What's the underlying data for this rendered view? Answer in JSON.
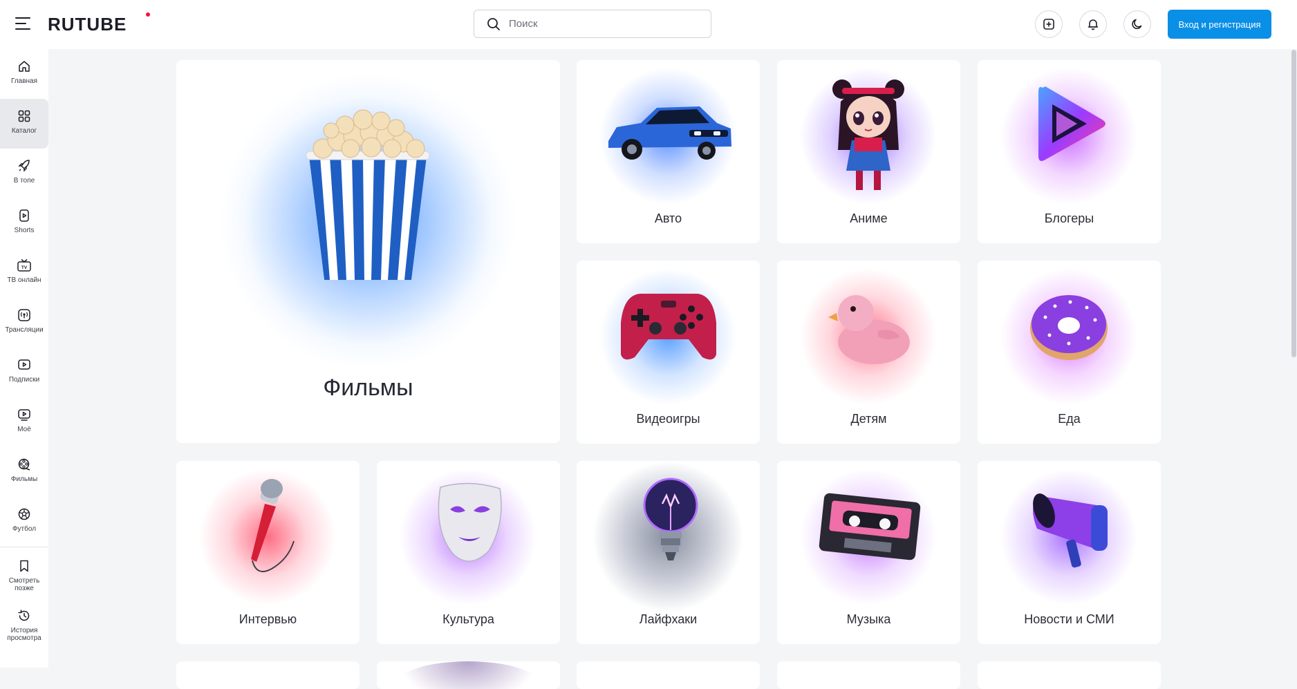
{
  "header": {
    "logo_text": "RUTUBE",
    "search_placeholder": "Поиск",
    "upload_icon": "plus-square-icon",
    "notifications_icon": "bell-icon",
    "theme_icon": "moon-icon",
    "login_label": "Вход и регистрация"
  },
  "sidebar": {
    "items": [
      {
        "label": "Главная",
        "icon": "home-icon"
      },
      {
        "label": "Каталог",
        "icon": "grid-icon",
        "active": true
      },
      {
        "label": "В топе",
        "icon": "rocket-icon"
      },
      {
        "label": "Shorts",
        "icon": "shorts-icon"
      },
      {
        "label": "ТВ онлайн",
        "icon": "tv-icon"
      },
      {
        "label": "Трансляции",
        "icon": "broadcast-icon"
      },
      {
        "label": "Подписки",
        "icon": "subscriptions-icon"
      },
      {
        "label": "Моё",
        "icon": "my-icon"
      },
      {
        "label": "Фильмы",
        "icon": "film-reel-icon"
      },
      {
        "label": "Футбол",
        "icon": "football-icon"
      },
      {
        "label": "Смотреть позже",
        "icon": "bookmark-icon"
      },
      {
        "label": "История просмотра",
        "icon": "history-icon"
      }
    ]
  },
  "catalog": {
    "featured": {
      "label": "Фильмы",
      "icon": "popcorn-icon"
    },
    "categories": [
      {
        "label": "Авто",
        "icon": "car-icon",
        "accent": "#3a7bff"
      },
      {
        "label": "Аниме",
        "icon": "anime-girl-icon",
        "accent": "#8a5cff"
      },
      {
        "label": "Блогеры",
        "icon": "play-triangle-icon",
        "accent": "#b04cff"
      },
      {
        "label": "Видеоигры",
        "icon": "gamepad-icon",
        "accent": "#3d8bff"
      },
      {
        "label": "Детям",
        "icon": "rubber-duck-icon",
        "accent": "#ff5c7a"
      },
      {
        "label": "Еда",
        "icon": "donut-icon",
        "accent": "#c64cff"
      },
      {
        "label": "Интервью",
        "icon": "microphone-icon",
        "accent": "#ff4d6d"
      },
      {
        "label": "Культура",
        "icon": "theatre-mask-icon",
        "accent": "#a24cff"
      },
      {
        "label": "Лайфхаки",
        "icon": "light-bulb-icon",
        "accent": "#5b6b8a"
      },
      {
        "label": "Музыка",
        "icon": "cassette-icon",
        "accent": "#b45cff"
      },
      {
        "label": "Новости и СМИ",
        "icon": "megaphone-icon",
        "accent": "#8a4cff"
      }
    ]
  }
}
